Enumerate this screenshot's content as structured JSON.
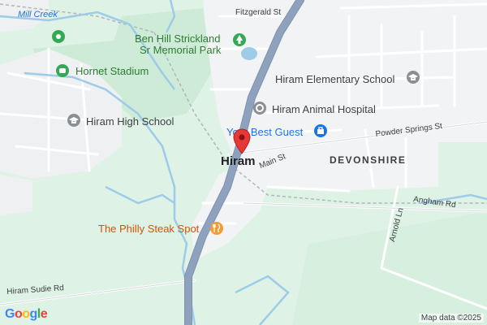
{
  "map": {
    "place_label": "Hiram",
    "area_label": "DEVONSHIRE",
    "water_label": "Mill Creek",
    "pois": [
      {
        "label": "Ben Hill Strickland",
        "icon": "tree-icon",
        "color": "#2e7d32"
      },
      {
        "label": "Sr Memorial Park",
        "icon": "",
        "color": "#2e7d32"
      },
      {
        "label": "Hornet Stadium",
        "icon": "stadium-icon",
        "color": "#2e7d32"
      },
      {
        "label": "Hiram High School",
        "icon": "school-icon",
        "color": "#757575"
      },
      {
        "label": "Hiram Elementary School",
        "icon": "school-icon",
        "color": "#757575"
      },
      {
        "label": "Hiram Animal Hospital",
        "icon": "hospital-icon",
        "color": "#757575"
      },
      {
        "label": "Your Best Guest",
        "icon": "shopping-bag-icon",
        "color": "#1a73e8"
      },
      {
        "label": "The Philly Steak Spot",
        "icon": "restaurant-icon",
        "color": "#e67e22"
      }
    ],
    "roads": {
      "fitzgerald": "Fitzgerald St",
      "powder_springs": "Powder Springs St",
      "main": "Main St",
      "angham": "Angham Rd",
      "arnold": "Arnold Ln",
      "hiram_sudie": "Hiram Sudie Rd"
    },
    "pin_color": "#e53935",
    "colors": {
      "park": "#c8ebd3",
      "land": "#dff2e6",
      "urban": "#f1f3f4",
      "highway": "#8ea1bd",
      "water": "#9ecbe8"
    }
  },
  "branding": {
    "logo_letters": [
      "G",
      "o",
      "o",
      "g",
      "l",
      "e"
    ],
    "logo_colors": [
      "#4285F4",
      "#EA4335",
      "#FBBC05",
      "#4285F4",
      "#34A853",
      "#EA4335"
    ],
    "credit": "Map data ©2025"
  }
}
